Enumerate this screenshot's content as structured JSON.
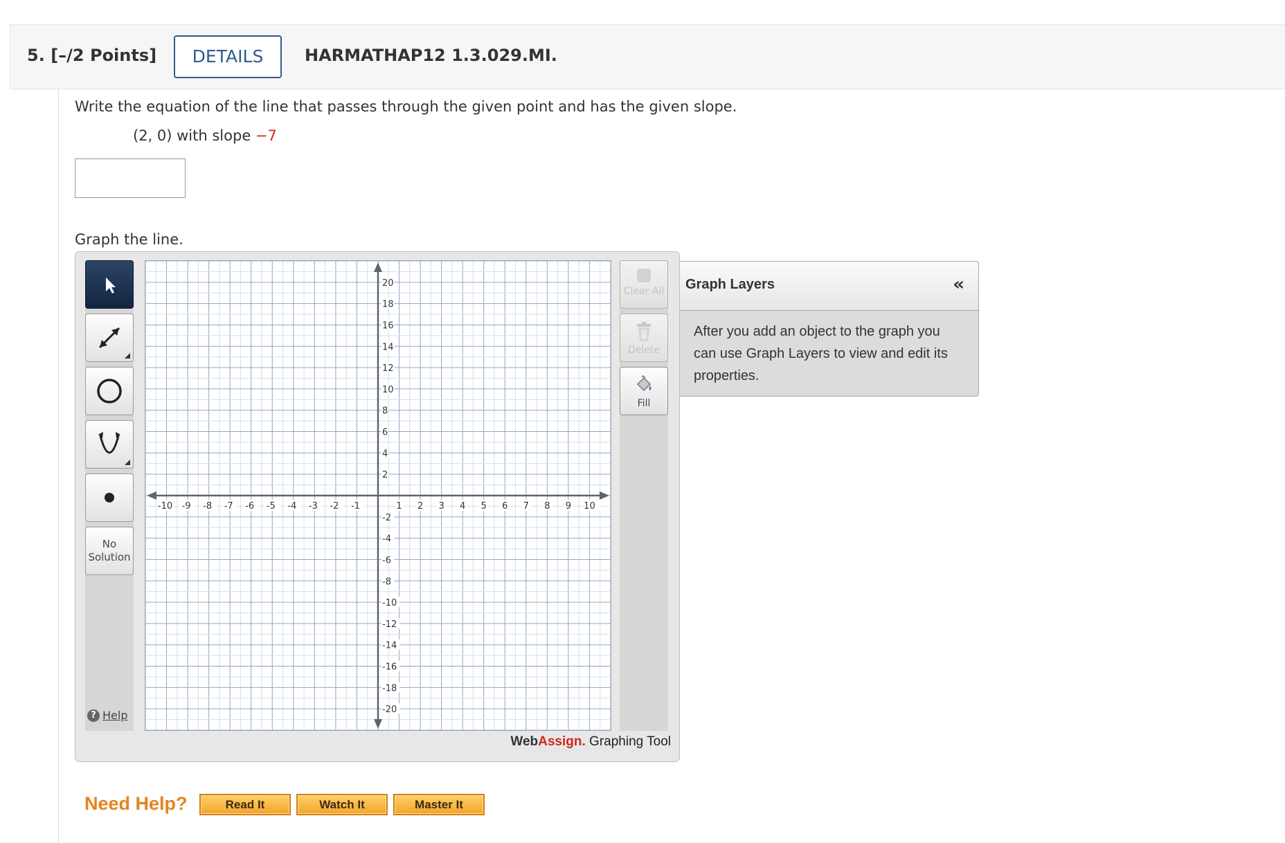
{
  "question": {
    "number_label": "5.",
    "points_label": "[–/2 Points]",
    "details_label": "DETAILS",
    "code": "HARMATHAP12 1.3.029.MI."
  },
  "problem": {
    "prompt": "Write the equation of the line that passes through the given point and has the given slope.",
    "point_text": "(2, 0) with slope ",
    "slope_value": "−7",
    "answer_value": "",
    "graph_label": "Graph the line."
  },
  "graph_tool": {
    "tools": [
      {
        "name": "select-tool",
        "icon": "pointer-arrow-icon",
        "active": true
      },
      {
        "name": "line-tool",
        "icon": "line-double-arrow-icon",
        "active": false
      },
      {
        "name": "circle-tool",
        "icon": "circle-icon",
        "active": false
      },
      {
        "name": "parabola-tool",
        "icon": "parabola-icon",
        "active": false
      },
      {
        "name": "point-tool",
        "icon": "point-dot-icon",
        "active": false
      }
    ],
    "no_solution_line1": "No",
    "no_solution_line2": "Solution",
    "help_label": "Help",
    "clear_all_label": "Clear All",
    "delete_label": "Delete",
    "fill_label": "Fill",
    "brand_web": "Web",
    "brand_assign": "Assign.",
    "brand_suffix": " Graphing Tool",
    "axes": {
      "x_range": [
        -11,
        11
      ],
      "y_range": [
        -22,
        22
      ],
      "x_ticks": [
        -10,
        -9,
        -8,
        -7,
        -6,
        -5,
        -4,
        -3,
        -2,
        -1,
        1,
        2,
        3,
        4,
        5,
        6,
        7,
        8,
        9,
        10
      ],
      "y_ticks": [
        20,
        18,
        16,
        14,
        12,
        10,
        8,
        6,
        4,
        2,
        -2,
        -4,
        -6,
        -8,
        -10,
        -12,
        -14,
        -16,
        -18,
        -20
      ],
      "grid": true
    }
  },
  "layers": {
    "title": "Graph Layers",
    "collapse_glyph": "«",
    "body": "After you add an object to the graph you can use Graph Layers to view and edit its properties."
  },
  "help_bar": {
    "need_help": "Need Help?",
    "buttons": [
      "Read It",
      "Watch It",
      "Master It"
    ]
  }
}
